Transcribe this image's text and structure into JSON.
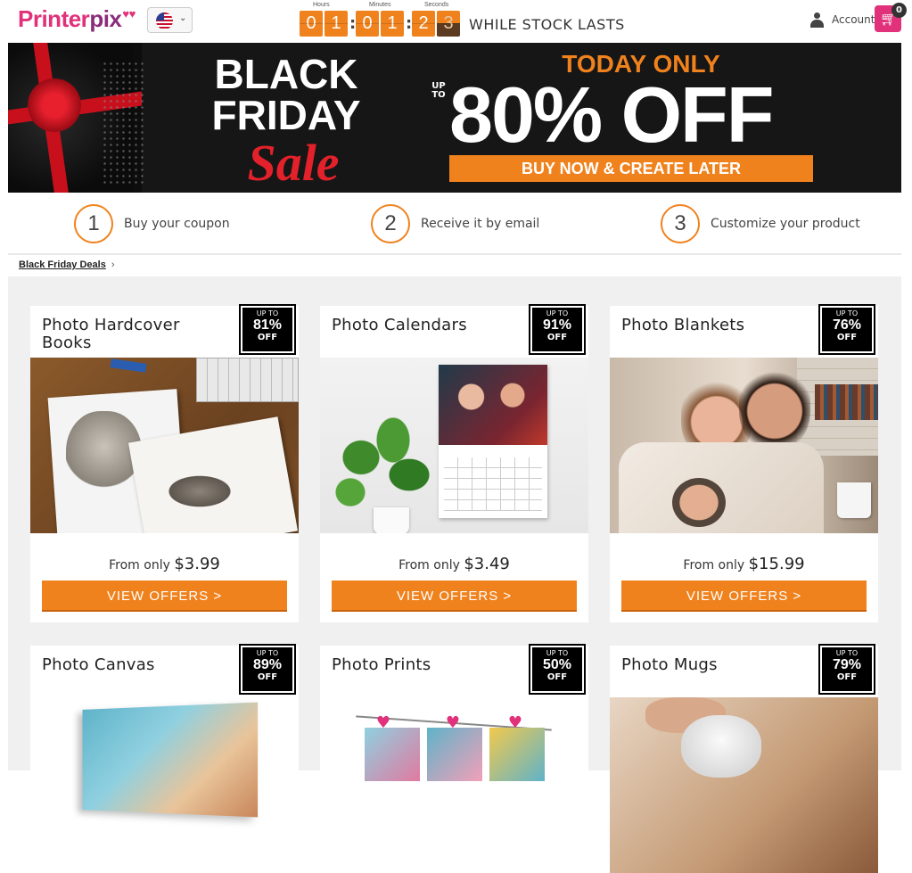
{
  "header": {
    "logo_part1": "Printer",
    "logo_part2": "pix",
    "account_label": "Account",
    "cart_count": "0",
    "timer": {
      "hours_label": "Hours",
      "minutes_label": "Minutes",
      "seconds_label": "Seconds",
      "h1": "0",
      "h2": "1",
      "m1": "0",
      "m2": "1",
      "s1": "2",
      "s2": "3"
    },
    "stock_text": "WHILE STOCK LASTS"
  },
  "banner": {
    "title_line1": "BLACK",
    "title_line2": "FRIDAY",
    "title_line3": "Sale",
    "today": "TODAY ONLY",
    "upto": "UP TO",
    "big_off": "80% OFF",
    "cta": "BUY NOW & CREATE LATER"
  },
  "steps": [
    {
      "num": "1",
      "text": "Buy your coupon"
    },
    {
      "num": "2",
      "text": "Receive it by email"
    },
    {
      "num": "3",
      "text": "Customize your product"
    }
  ],
  "breadcrumb": {
    "label": "Black Friday Deals",
    "sep": "›"
  },
  "cards": [
    {
      "title": "Photo Hardcover Books",
      "upto": "UP TO",
      "pct": "81%",
      "off": "OFF",
      "from": "From only",
      "price": "$3.99",
      "cta": "VIEW OFFERS >"
    },
    {
      "title": "Photo Calendars",
      "upto": "UP TO",
      "pct": "91%",
      "off": "OFF",
      "from": "From only",
      "price": "$3.49",
      "cta": "VIEW OFFERS >"
    },
    {
      "title": "Photo Blankets",
      "upto": "UP TO",
      "pct": "76%",
      "off": "OFF",
      "from": "From only",
      "price": "$15.99",
      "cta": "VIEW OFFERS >"
    },
    {
      "title": "Photo Canvas",
      "upto": "UP TO",
      "pct": "89%",
      "off": "OFF"
    },
    {
      "title": "Photo Prints",
      "upto": "UP TO",
      "pct": "50%",
      "off": "OFF"
    },
    {
      "title": "Photo Mugs",
      "upto": "UP TO",
      "pct": "79%",
      "off": "OFF"
    }
  ],
  "colors": {
    "accent": "#f0821e",
    "brand": "#e0317a"
  },
  "icons": [
    "us-flag-icon",
    "chevron-down-icon",
    "user-icon",
    "cart-icon"
  ]
}
